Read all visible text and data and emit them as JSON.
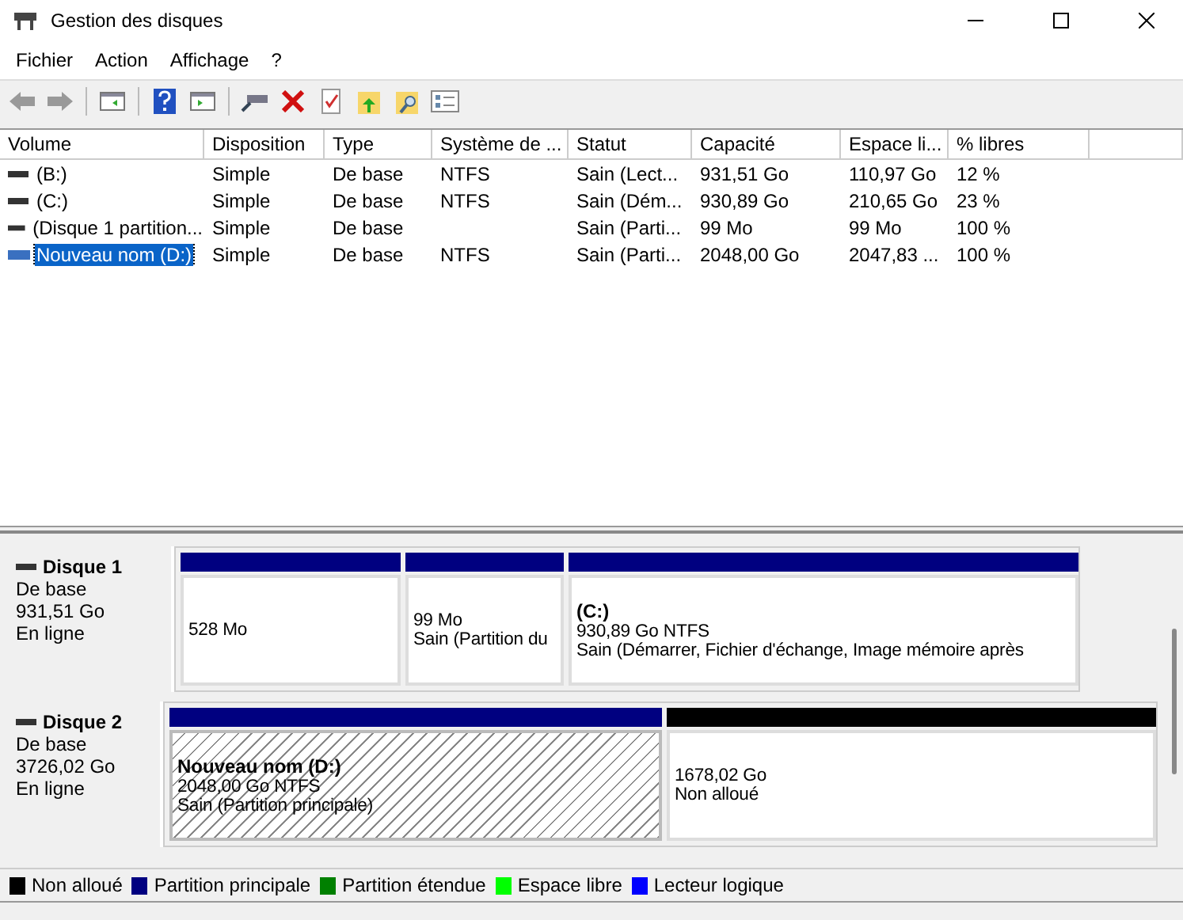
{
  "window": {
    "title": "Gestion des disques"
  },
  "menu": [
    "Fichier",
    "Action",
    "Affichage",
    "?"
  ],
  "volumes": {
    "columns": [
      "Volume",
      "Disposition",
      "Type",
      "Système de ...",
      "Statut",
      "Capacité",
      "Espace li...",
      "% libres"
    ],
    "rows": [
      {
        "selected": false,
        "cells": [
          "(B:)",
          "Simple",
          "De base",
          "NTFS",
          "Sain (Lect...",
          "931,51 Go",
          "110,97 Go",
          "12 %"
        ]
      },
      {
        "selected": false,
        "cells": [
          "(C:)",
          "Simple",
          "De base",
          "NTFS",
          "Sain (Dém...",
          "930,89 Go",
          "210,65 Go",
          "23 %"
        ]
      },
      {
        "selected": false,
        "cells": [
          "(Disque 1 partition...",
          "Simple",
          "De base",
          "",
          "Sain (Parti...",
          "99 Mo",
          "99 Mo",
          "100 %"
        ]
      },
      {
        "selected": true,
        "cells": [
          "Nouveau nom (D:)",
          "Simple",
          "De base",
          "NTFS",
          "Sain (Parti...",
          "2048,00 Go",
          "2047,83 ...",
          "100 %"
        ]
      }
    ]
  },
  "disks": [
    {
      "name": "Disque 1",
      "type": "De base",
      "size": "931,51 Go",
      "status": "En ligne",
      "partitions": [
        {
          "kind": "primary",
          "selected": false,
          "lines": [
            "528 Mo"
          ]
        },
        {
          "kind": "primary",
          "selected": false,
          "lines": [
            "99 Mo",
            "Sain (Partition du"
          ]
        },
        {
          "kind": "primary",
          "selected": false,
          "title": "(C:)",
          "lines": [
            "930,89 Go NTFS",
            "Sain (Démarrer, Fichier d'échange, Image mémoire après"
          ]
        }
      ]
    },
    {
      "name": "Disque 2",
      "type": "De base",
      "size": "3726,02 Go",
      "status": "En ligne",
      "partitions": [
        {
          "kind": "primary",
          "selected": true,
          "title": "Nouveau nom  (D:)",
          "lines": [
            "2048,00 Go NTFS",
            "Sain (Partition principale)"
          ]
        },
        {
          "kind": "unallocated",
          "selected": false,
          "lines": [
            "1678,02 Go",
            "Non alloué"
          ]
        }
      ]
    }
  ],
  "legend": [
    {
      "label": "Non alloué",
      "color": "#000000"
    },
    {
      "label": "Partition principale",
      "color": "#000080"
    },
    {
      "label": "Partition étendue",
      "color": "#008000"
    },
    {
      "label": "Espace libre",
      "color": "#00ff00"
    },
    {
      "label": "Lecteur logique",
      "color": "#0000ff"
    }
  ]
}
